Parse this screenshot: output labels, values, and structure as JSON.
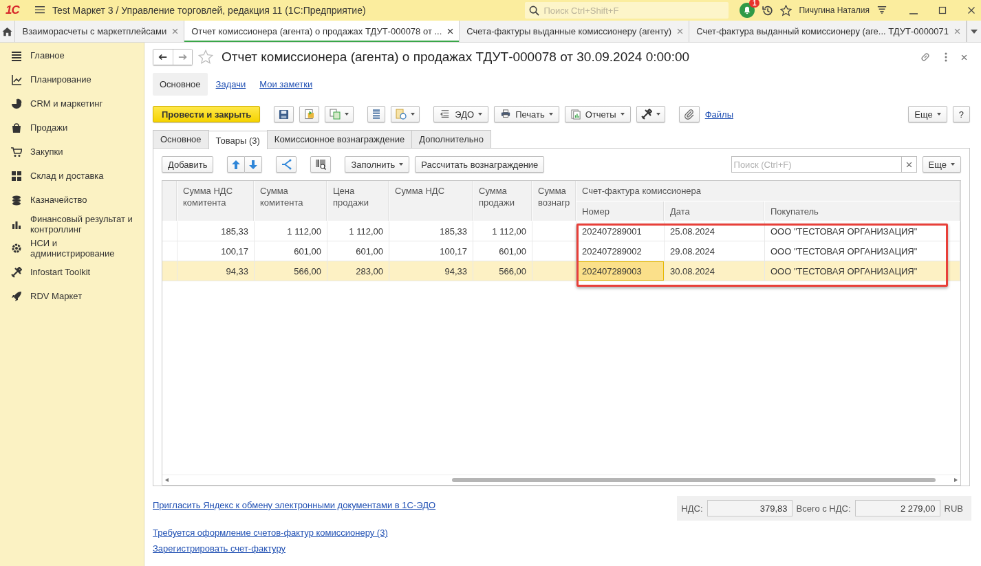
{
  "app": {
    "logo": "1С",
    "title": "Test Маркет 3 / Управление торговлей, редакция 11 (1С:Предприятие)",
    "search_placeholder": "Поиск Ctrl+Shift+F",
    "notifications": "1",
    "user": "Пичугина Наталия"
  },
  "open_tabs": [
    {
      "label": "Взаиморасчеты с маркетплейсами",
      "selected": false
    },
    {
      "label": "Отчет комиссионера (агента) о продажах ТДУТ-000078 от ...",
      "selected": true
    },
    {
      "label": "Счета-фактуры выданные комиссионеру (агенту)",
      "selected": false
    },
    {
      "label": "Счет-фактура выданный комиссионеру (аге... ТДУТ-0000071",
      "selected": false
    }
  ],
  "sidebar": {
    "items": [
      {
        "label": "Главное"
      },
      {
        "label": "Планирование"
      },
      {
        "label": "CRM и маркетинг"
      },
      {
        "label": "Продажи"
      },
      {
        "label": "Закупки"
      },
      {
        "label": "Склад и доставка"
      },
      {
        "label": "Казначейство"
      },
      {
        "label": "Финансовый результат и контроллинг"
      },
      {
        "label": "НСИ и администрирование"
      },
      {
        "label": "Infostart Toolkit"
      },
      {
        "label": "RDV Маркет"
      }
    ]
  },
  "form": {
    "title": "Отчет комиссионера (агента) о продажах ТДУТ-000078 от 30.09.2024 0:00:00",
    "nav": [
      {
        "label": "Основное",
        "selected": true
      },
      {
        "label": "Задачи",
        "selected": false
      },
      {
        "label": "Мои заметки",
        "selected": false
      }
    ],
    "commands": {
      "primary": "Провести и закрыть",
      "edo": "ЭДО",
      "print": "Печать",
      "reports": "Отчеты",
      "files": "Файлы",
      "more": "Еще",
      "help": "?"
    },
    "tabs": [
      {
        "label": "Основное",
        "selected": false
      },
      {
        "label": "Товары (3)",
        "selected": true
      },
      {
        "label": "Комиссионное вознаграждение",
        "selected": false
      },
      {
        "label": "Дополнительно",
        "selected": false
      }
    ],
    "table_toolbar": {
      "add": "Добавить",
      "fill": "Заполнить",
      "calculate": "Рассчитать вознаграждение",
      "search_placeholder": "Поиск (Ctrl+F)",
      "more": "Еще"
    },
    "table": {
      "columns": [
        "Сумма НДС\nкомитента",
        "Сумма\nкомитента",
        "Цена\nпродажи",
        "Сумма НДС",
        "Сумма\nпродажи",
        "Сумма\nвознагр"
      ],
      "group": {
        "title": "Счет-фактура комиссионера",
        "columns": [
          "Номер",
          "Дата",
          "Покупатель"
        ]
      },
      "rows": [
        {
          "values": [
            "185,33",
            "1 112,00",
            "1 112,00",
            "185,33",
            "1 112,00"
          ],
          "invoice": [
            "202407289001",
            "25.08.2024",
            "ООО \"ТЕСТОВАЯ ОРГАНИЗАЦИЯ\""
          ],
          "selected": false,
          "number_focused": false
        },
        {
          "values": [
            "100,17",
            "601,00",
            "601,00",
            "100,17",
            "601,00"
          ],
          "invoice": [
            "202407289002",
            "29.08.2024",
            "ООО \"ТЕСТОВАЯ ОРГАНИЗАЦИЯ\""
          ],
          "selected": false,
          "number_focused": false
        },
        {
          "values": [
            "94,33",
            "566,00",
            "283,00",
            "94,33",
            "566,00"
          ],
          "invoice": [
            "202407289003",
            "30.08.2024",
            "ООО \"ТЕСТОВАЯ ОРГАНИЗАЦИЯ\""
          ],
          "selected": true,
          "number_focused": true
        }
      ]
    },
    "footer": {
      "invite_link": "Пригласить Яндекс к обмену электронными документами в 1С-ЭДО",
      "vat_label": "НДС:",
      "vat": "379,83",
      "total_label": "Всего с НДС:",
      "total": "2 279,00",
      "currency": "RUB",
      "links": [
        "Требуется оформление счетов-фактур комиссионеру (3)",
        "Зарегистрировать счет-фактуру"
      ]
    }
  }
}
